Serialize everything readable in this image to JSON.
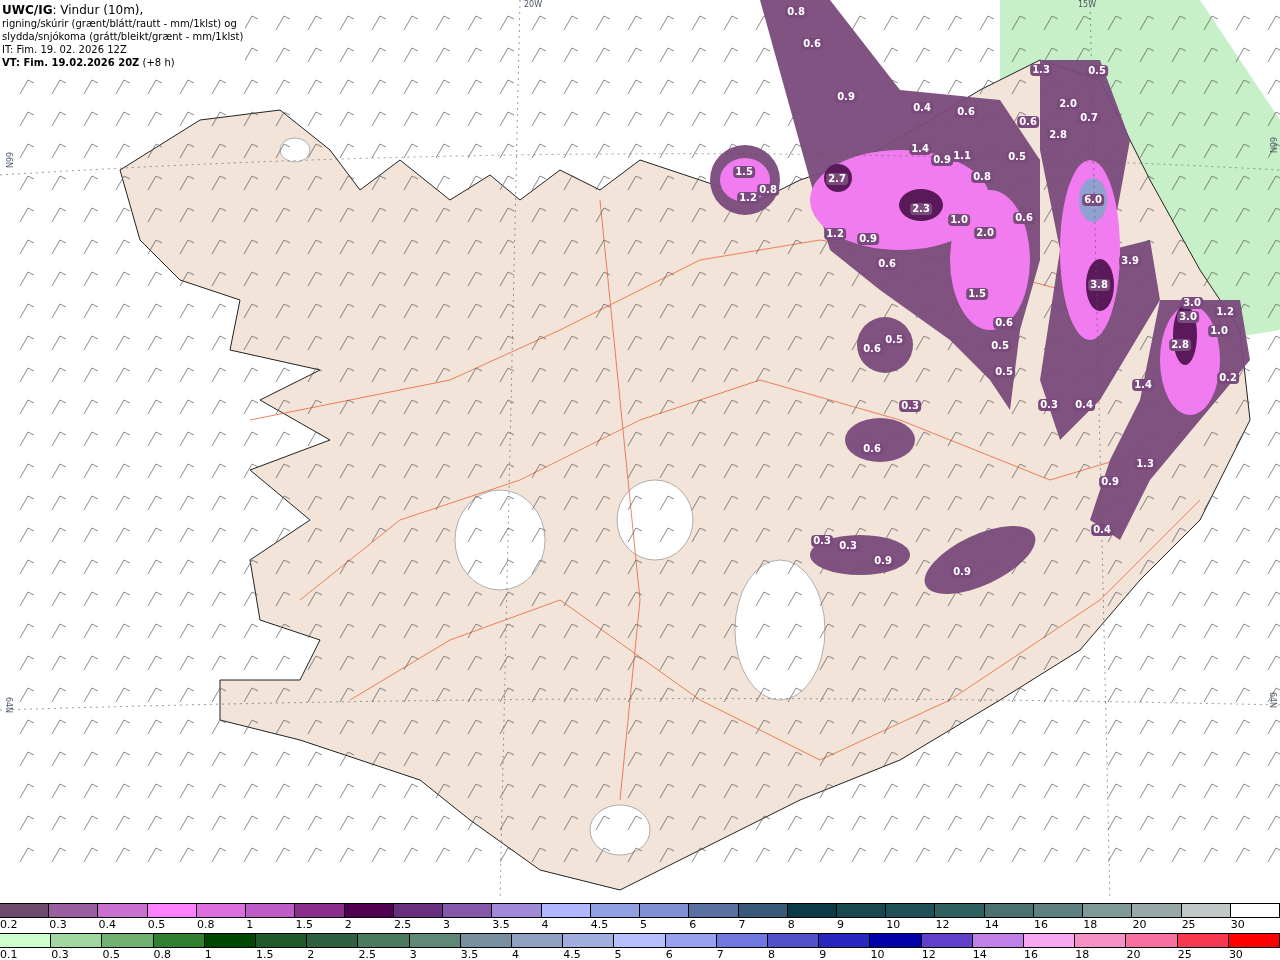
{
  "header": {
    "lines": [
      "**UWC/IG**: Vindur (10m),",
      "rigning/skúrir (grænt/blátt/rautt - mm/1klst) og",
      "slydda/snjókoma (grátt/bleikt/grænt - mm/1klst)",
      "IT: Fim. 19. 02. 2026 12Z",
      "**VT: Fim. 19.02.2026 20Z** (+8 h)"
    ]
  },
  "grid_labels": {
    "top": [
      "20W",
      "15W"
    ],
    "left": [
      "66N",
      "64N"
    ],
    "right": [
      "66N",
      "64N"
    ]
  },
  "map_values": [
    "0.8",
    "0.6",
    "0.9",
    "1.5",
    "0.8",
    "1.2",
    "2.7",
    "0.4",
    "0.6",
    "1.4",
    "0.9",
    "1.1",
    "0.8",
    "2.3",
    "1.0",
    "2.0",
    "0.6",
    "1.2",
    "0.9",
    "0.6",
    "1.5",
    "0.6",
    "0.5",
    "0.5",
    "0.6",
    "0.5",
    "0.5",
    "2.0",
    "0.7",
    "2.8",
    "0.6",
    "1.3",
    "0.5",
    "6.0",
    "3.9",
    "3.8",
    "3.0",
    "3.0",
    "1.2",
    "1.0",
    "2.8",
    "1.4",
    "0.2",
    "0.3",
    "0.3",
    "0.4",
    "0.6",
    "1.3",
    "0.9",
    "0.4",
    "0.3",
    "0.3",
    "0.9",
    "0.9"
  ],
  "legend_snow": [
    {
      "label": "0.2",
      "color": "#6d4a6e"
    },
    {
      "label": "0.3",
      "color": "#9a5fa0"
    },
    {
      "label": "0.4",
      "color": "#c86fd0"
    },
    {
      "label": "0.5",
      "color": "#ff80ff"
    },
    {
      "label": "0.8",
      "color": "#dd6ee0"
    },
    {
      "label": "1",
      "color": "#c05cc8"
    },
    {
      "label": "1.5",
      "color": "#8c2c8c"
    },
    {
      "label": "2",
      "color": "#500050"
    },
    {
      "label": "2.5",
      "color": "#6a2e7e"
    },
    {
      "label": "3",
      "color": "#8457a8"
    },
    {
      "label": "3.5",
      "color": "#a08ad8"
    },
    {
      "label": "4",
      "color": "#b0b8ff"
    },
    {
      "label": "4.5",
      "color": "#90a0e0"
    },
    {
      "label": "5",
      "color": "#8090d0"
    },
    {
      "label": "6",
      "color": "#5a70a0"
    },
    {
      "label": "7",
      "color": "#3a5878"
    },
    {
      "label": "8",
      "color": "#0a3a48"
    },
    {
      "label": "9",
      "color": "#184850"
    },
    {
      "label": "10",
      "color": "#1f5058"
    },
    {
      "label": "12",
      "color": "#2f6060"
    },
    {
      "label": "14",
      "color": "#4a7070"
    },
    {
      "label": "16",
      "color": "#5f8080"
    },
    {
      "label": "18",
      "color": "#7f9898"
    },
    {
      "label": "20",
      "color": "#98a8a8"
    },
    {
      "label": "25",
      "color": "#c0c8c8"
    },
    {
      "label": "30",
      "color": "#ffffff"
    }
  ],
  "legend_rain": [
    {
      "label": "0.1",
      "color": "#ccffcc"
    },
    {
      "label": "0.3",
      "color": "#a0d8a0"
    },
    {
      "label": "0.5",
      "color": "#70b070"
    },
    {
      "label": "0.8",
      "color": "#308030"
    },
    {
      "label": "1",
      "color": "#004800"
    },
    {
      "label": "1.5",
      "color": "#1f5a28"
    },
    {
      "label": "2",
      "color": "#2f6040"
    },
    {
      "label": "2.5",
      "color": "#4a7a60"
    },
    {
      "label": "3",
      "color": "#608878"
    },
    {
      "label": "3.5",
      "color": "#7890a0"
    },
    {
      "label": "4",
      "color": "#90a0c0"
    },
    {
      "label": "4.5",
      "color": "#a0aee0"
    },
    {
      "label": "5",
      "color": "#b8c0ff"
    },
    {
      "label": "6",
      "color": "#98a0f0"
    },
    {
      "label": "7",
      "color": "#7078e0"
    },
    {
      "label": "8",
      "color": "#5050c8"
    },
    {
      "label": "9",
      "color": "#2828c0"
    },
    {
      "label": "10",
      "color": "#0000a8"
    },
    {
      "label": "12",
      "color": "#6040c8"
    },
    {
      "label": "14",
      "color": "#c080e8"
    },
    {
      "label": "16",
      "color": "#f8a8f0"
    },
    {
      "label": "18",
      "color": "#f890c8"
    },
    {
      "label": "20",
      "color": "#f870a0"
    },
    {
      "label": "25",
      "color": "#f83850"
    },
    {
      "label": "30",
      "color": "#ff0000"
    }
  ]
}
